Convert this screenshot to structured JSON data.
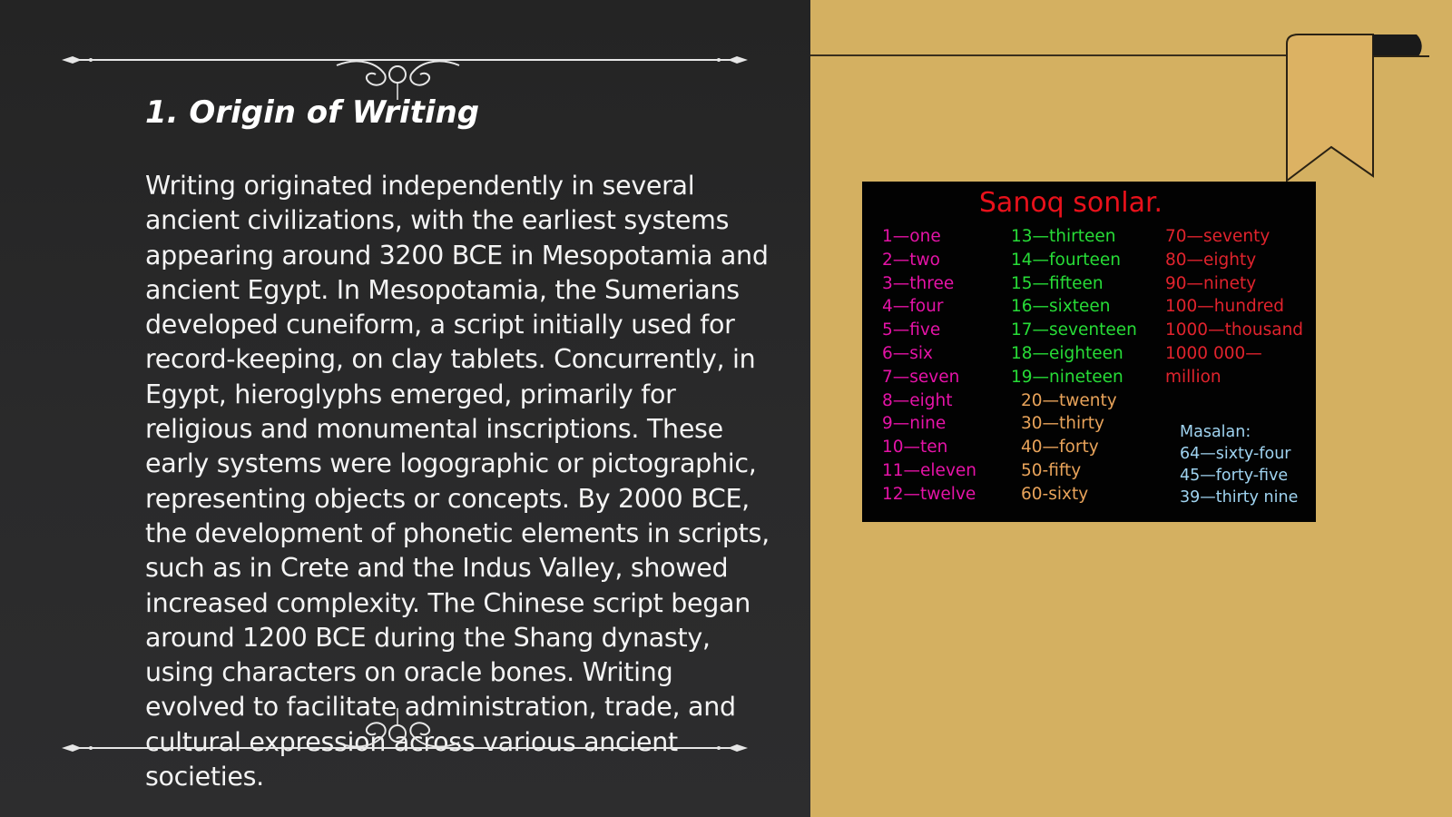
{
  "slide": {
    "title": "1. Origin of Writing",
    "body": "Writing originated independently in several ancient civilizations, with the earliest systems appearing around 3200 BCE in Mesopotamia and ancient Egypt. In Mesopotamia, the Sumerians developed cuneiform, a script initially used for record-keeping, on clay tablets. Concurrently, in Egypt, hieroglyphs emerged, primarily for religious and monumental inscriptions. These early systems were logographic or pictographic, representing objects or concepts. By 2000 BCE, the development of phonetic elements in scripts, such as in Crete and the Indus Valley, showed increased complexity. The Chinese script began around 1200 BCE during the Shang dynasty, using characters on oracle bones. Writing evolved to facilitate administration, trade, and cultural expression across various ancient societies."
  },
  "image": {
    "title": "Sanoq sonlar.",
    "col1": [
      "1—one",
      "2—two",
      "3—three",
      "4—four",
      "5—five",
      "6—six",
      "7—seven",
      "8—eight",
      "9—nine",
      "10—ten",
      "11—eleven",
      "12—twelve"
    ],
    "col2": [
      "13—thirteen",
      "14—fourteen",
      "15—fifteen",
      "16—sixteen",
      "17—seventeen",
      "18—eighteen",
      "19—nineteen"
    ],
    "col2_tens": [
      "20—twenty",
      "30—thirty",
      "40—forty",
      "50-fifty",
      "60-sixty"
    ],
    "col3": [
      "70—seventy",
      "80—eighty",
      "90—ninety",
      "100—hundred",
      "1000—thousand",
      "1000 000—",
      "million"
    ],
    "examples": [
      "Masalan:",
      "64—sixty-four",
      "45—forty-five",
      "39—thirty nine"
    ]
  },
  "colors": {
    "left_background": "#2a2a2b",
    "right_background": "#d4b061",
    "ribbon": "#dcb263",
    "col1_text": "#e513a7",
    "col2_text": "#27dc37",
    "tens_text": "#e8a35a",
    "col3_text": "#e0232d",
    "examples_text": "#9fd3f0",
    "image_title": "#e8111b"
  }
}
